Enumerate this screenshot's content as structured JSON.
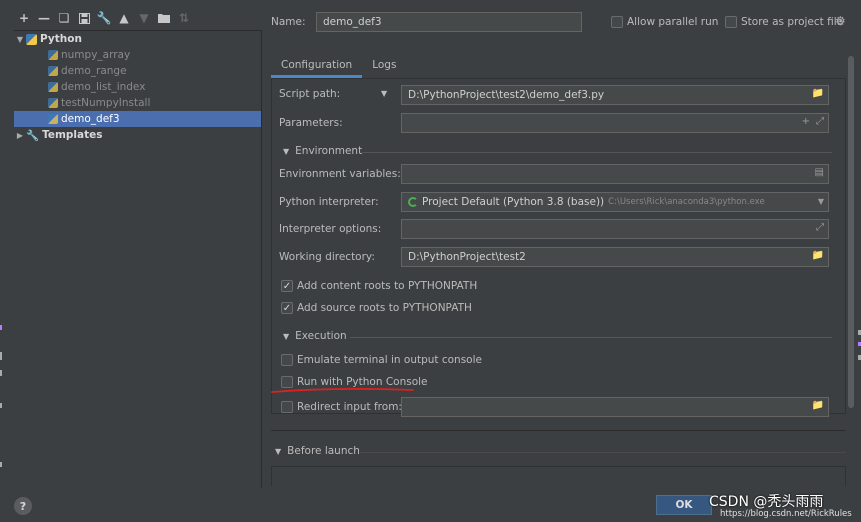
{
  "toolbar": {
    "icons": [
      "add-icon",
      "remove-icon",
      "copy-icon",
      "save-icon",
      "wrench-icon",
      "move-up-icon",
      "move-down-icon",
      "folder-icon",
      "sort-icon"
    ]
  },
  "tree": {
    "python_group": "Python",
    "items": [
      "numpy_array",
      "demo_range",
      "demo_list_index",
      "testNumpyInstall",
      "demo_def3"
    ],
    "selected": "demo_def3",
    "templates": "Templates"
  },
  "header": {
    "name_label": "Name:",
    "name_value": "demo_def3",
    "allow_parallel": "Allow parallel run",
    "store_project": "Store as project file"
  },
  "tabs": [
    "Configuration",
    "Logs"
  ],
  "config": {
    "script_path_label": "Script path:",
    "script_path_value": "D:\\PythonProject\\test2\\demo_def3.py",
    "parameters_label": "Parameters:",
    "parameters_value": "",
    "environment_section": "Environment",
    "env_vars_label": "Environment variables:",
    "env_vars_value": "",
    "interpreter_label": "Python interpreter:",
    "interpreter_value": "Project Default (Python 3.8 (base))",
    "interpreter_path": "C:\\Users\\Rick\\anaconda3\\python.exe",
    "interp_options_label": "Interpreter options:",
    "interp_options_value": "",
    "working_dir_label": "Working directory:",
    "working_dir_value": "D:\\PythonProject\\test2",
    "content_roots": "Add content roots to PYTHONPATH",
    "source_roots": "Add source roots to PYTHONPATH",
    "execution_section": "Execution",
    "emulate_terminal": "Emulate terminal in output console",
    "run_console": "Run with Python Console",
    "redirect_input": "Redirect input from:",
    "redirect_value": ""
  },
  "before_launch": "Before launch",
  "footer": {
    "help": "?",
    "ok": "OK",
    "watermark": "CSDN @秃头雨雨",
    "watermark_url": "https://blog.csdn.net/RickRules"
  },
  "colors": {
    "selection": "#4b6eaf",
    "ok_button": "#365880",
    "underline": "#e02020",
    "tab_active": "#4a88c7"
  }
}
